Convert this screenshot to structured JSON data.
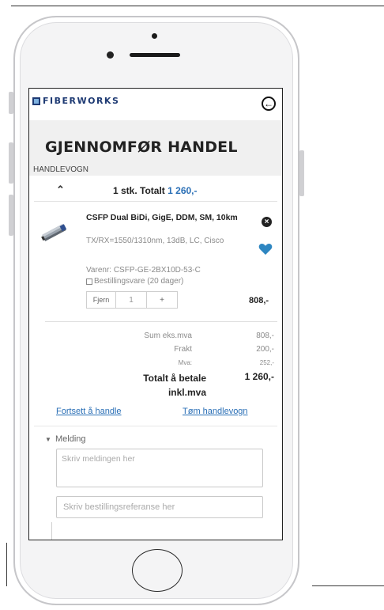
{
  "header": {
    "logo_text": "FIBERWORKS",
    "back_icon": "back-circle-arrow-icon"
  },
  "page": {
    "title": "GJENNOMFØR HANDEL",
    "breadcrumb": "HANDLEVOGN"
  },
  "cart_summary": {
    "label": "1 stk. Totalt",
    "total": "1 260,-"
  },
  "product": {
    "title": "CSFP Dual BiDi, GigE, DDM, SM, 10km",
    "spec": "TX/RX=1550/1310nm, 13dB, LC, Cisco",
    "varenr": "Varenr: CSFP-GE-2BX10D-53-C",
    "stock": "Bestillingsvare (20 dager)",
    "qty_remove_label": "Fjern",
    "qty_value": "1",
    "qty_plus_label": "+",
    "line_price": "808,-"
  },
  "totals": {
    "sum_label": "Sum eks.mva",
    "sum_value": "808,-",
    "frakt_label": "Frakt",
    "frakt_value": "200,-",
    "mva_label": "Mva:",
    "mva_value": "252,-",
    "total_label_line1": "Totalt å betale",
    "total_label_line2": "inkl.mva",
    "total_value": "1 260,-"
  },
  "links": {
    "continue": "Fortsett å handle",
    "empty": "Tøm handlevogn"
  },
  "message": {
    "section_label": "Melding",
    "textarea_placeholder": "Skriv meldingen her",
    "reference_placeholder": "Skriv bestillingsreferanse her"
  },
  "colors": {
    "brand": "#1e3a73",
    "link": "#2a6fb6",
    "heart": "#2e86c1"
  }
}
